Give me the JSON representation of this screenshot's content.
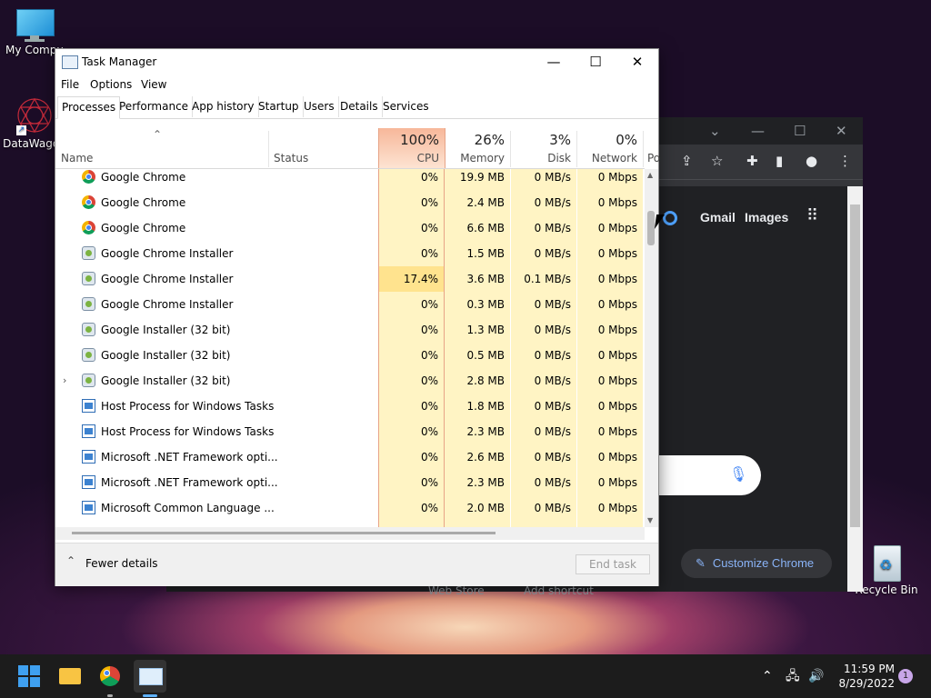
{
  "desktop": {
    "icons": [
      {
        "label": "My Compu"
      },
      {
        "label": "DataWagon"
      },
      {
        "label": "Recycle Bin"
      }
    ]
  },
  "chrome": {
    "links": [
      "Gmail",
      "Images"
    ],
    "customize_label": "Customize Chrome",
    "footer_links": [
      "Web Store",
      "Add shortcut"
    ]
  },
  "task_manager": {
    "title": "Task Manager",
    "menu": [
      "File",
      "Options",
      "View"
    ],
    "tabs": [
      "Processes",
      "Performance",
      "App history",
      "Startup",
      "Users",
      "Details",
      "Services"
    ],
    "active_tab": "Processes",
    "columns": {
      "name": "Name",
      "status": "Status",
      "cpu": {
        "pct": "100%",
        "label": "CPU"
      },
      "memory": {
        "pct": "26%",
        "label": "Memory"
      },
      "disk": {
        "pct": "3%",
        "label": "Disk"
      },
      "network": {
        "pct": "0%",
        "label": "Network"
      },
      "power": "Po"
    },
    "rows": [
      {
        "name": "Google Chrome",
        "icon": "chrome-icon",
        "cpu": "0%",
        "memory": "19.9 MB",
        "disk": "0 MB/s",
        "network": "0 Mbps"
      },
      {
        "name": "Google Chrome",
        "icon": "chrome-icon",
        "cpu": "0%",
        "memory": "2.4 MB",
        "disk": "0 MB/s",
        "network": "0 Mbps"
      },
      {
        "name": "Google Chrome",
        "icon": "chrome-icon",
        "cpu": "0%",
        "memory": "6.6 MB",
        "disk": "0 MB/s",
        "network": "0 Mbps"
      },
      {
        "name": "Google Chrome Installer",
        "icon": "installer-icon",
        "cpu": "0%",
        "memory": "1.5 MB",
        "disk": "0 MB/s",
        "network": "0 Mbps"
      },
      {
        "name": "Google Chrome Installer",
        "icon": "installer-icon",
        "cpu": "17.4%",
        "memory": "3.6 MB",
        "disk": "0.1 MB/s",
        "network": "0 Mbps"
      },
      {
        "name": "Google Chrome Installer",
        "icon": "installer-icon",
        "cpu": "0%",
        "memory": "0.3 MB",
        "disk": "0 MB/s",
        "network": "0 Mbps"
      },
      {
        "name": "Google Installer (32 bit)",
        "icon": "installer-icon",
        "cpu": "0%",
        "memory": "1.3 MB",
        "disk": "0 MB/s",
        "network": "0 Mbps"
      },
      {
        "name": "Google Installer (32 bit)",
        "icon": "installer-icon",
        "cpu": "0%",
        "memory": "0.5 MB",
        "disk": "0 MB/s",
        "network": "0 Mbps"
      },
      {
        "name": "Google Installer (32 bit)",
        "icon": "installer-icon",
        "cpu": "0%",
        "memory": "2.8 MB",
        "disk": "0 MB/s",
        "network": "0 Mbps",
        "expandable": true
      },
      {
        "name": "Host Process for Windows Tasks",
        "icon": "host-process-icon",
        "cpu": "0%",
        "memory": "1.8 MB",
        "disk": "0 MB/s",
        "network": "0 Mbps"
      },
      {
        "name": "Host Process for Windows Tasks",
        "icon": "host-process-icon",
        "cpu": "0%",
        "memory": "2.3 MB",
        "disk": "0 MB/s",
        "network": "0 Mbps"
      },
      {
        "name": "Microsoft .NET Framework opti...",
        "icon": "host-process-icon",
        "cpu": "0%",
        "memory": "2.6 MB",
        "disk": "0 MB/s",
        "network": "0 Mbps"
      },
      {
        "name": "Microsoft .NET Framework opti...",
        "icon": "host-process-icon",
        "cpu": "0%",
        "memory": "2.3 MB",
        "disk": "0 MB/s",
        "network": "0 Mbps"
      },
      {
        "name": "Microsoft Common Language ...",
        "icon": "host-process-icon",
        "cpu": "0%",
        "memory": "2.0 MB",
        "disk": "0 MB/s",
        "network": "0 Mbps"
      }
    ],
    "fewer_details": "Fewer details",
    "end_task": "End task"
  },
  "taskbar": {
    "apps": [
      "start-icon",
      "file-explorer-icon",
      "chrome-icon",
      "task-manager-icon"
    ],
    "time": "11:59 PM",
    "date": "8/29/2022",
    "notification_count": "1"
  },
  "colors": {
    "cpu_header_bg": "#f9c8a8",
    "col_bg": "#fff4c4",
    "highlight_bg": "#ffe38e",
    "chrome_dark": "#202124",
    "accent": "#8ab4f8"
  }
}
